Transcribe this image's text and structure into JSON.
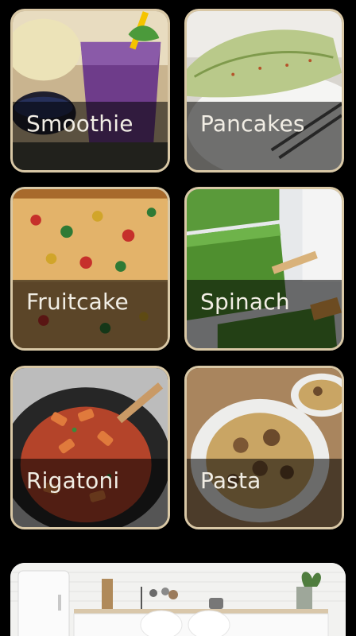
{
  "categories": [
    {
      "id": "smoothie",
      "label": "Smoothie"
    },
    {
      "id": "pancakes",
      "label": "Pancakes"
    },
    {
      "id": "fruitcake",
      "label": "Fruitcake"
    },
    {
      "id": "spinach",
      "label": "Spinach"
    },
    {
      "id": "rigatoni",
      "label": "Rigatoni"
    },
    {
      "id": "pasta",
      "label": "Pasta"
    }
  ],
  "colors": {
    "background": "#000000",
    "card_border": "#d9c8a6",
    "label_text": "#f1ede4"
  }
}
